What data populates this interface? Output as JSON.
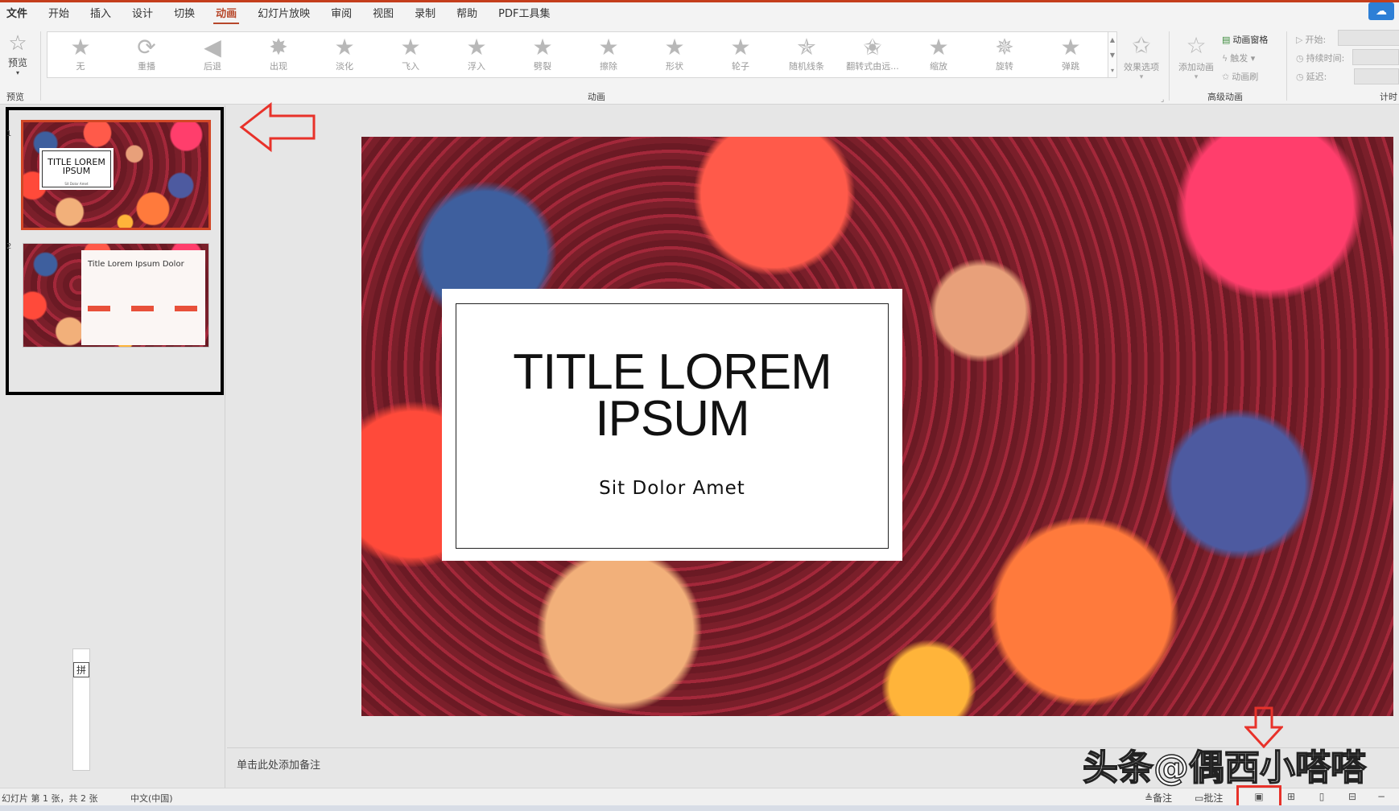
{
  "menu": {
    "tabs": [
      "文件",
      "开始",
      "插入",
      "设计",
      "切换",
      "动画",
      "幻灯片放映",
      "审阅",
      "视图",
      "录制",
      "帮助",
      "PDF工具集"
    ],
    "active": "动画"
  },
  "ribbon": {
    "preview": {
      "label": "预览",
      "group": "预览"
    },
    "animations": {
      "group": "动画",
      "items": [
        "无",
        "重播",
        "后退",
        "出现",
        "淡化",
        "飞入",
        "浮入",
        "劈裂",
        "擦除",
        "形状",
        "轮子",
        "随机线条",
        "翻转式由远...",
        "缩放",
        "旋转",
        "弹跳"
      ]
    },
    "effect_options": "效果选项",
    "add_animation": "添加动画",
    "advanced": {
      "group": "高级动画",
      "animation_pane": "动画窗格",
      "trigger": "触发",
      "animation_painter": "动画刷"
    },
    "timing": {
      "group": "计时",
      "start": "开始:",
      "duration": "持续时间:",
      "delay": "延迟:"
    }
  },
  "slides": [
    {
      "number": "1",
      "title": "TITLE LOREM IPSUM",
      "subtitle": "Sit Dolor Amet"
    },
    {
      "number": "2",
      "title": "Title Lorem Ipsum Dolor"
    }
  ],
  "main_slide": {
    "title_line1": "TITLE LOREM",
    "title_line2": "IPSUM",
    "subtitle": "Sit Dolor Amet"
  },
  "notes": {
    "placeholder": "单击此处添加备注"
  },
  "ime": {
    "label": "拼"
  },
  "watermark": "头条@偶西小嗒嗒",
  "status": {
    "slide_info": "幻灯片 第 1 张，共 2 张",
    "language": "中文(中国)",
    "notes_btn": "备注",
    "comments_btn": "批注"
  },
  "colors": {
    "accent": "#b7472a",
    "annotation_red": "#e8322a",
    "highlight": "#000000"
  }
}
